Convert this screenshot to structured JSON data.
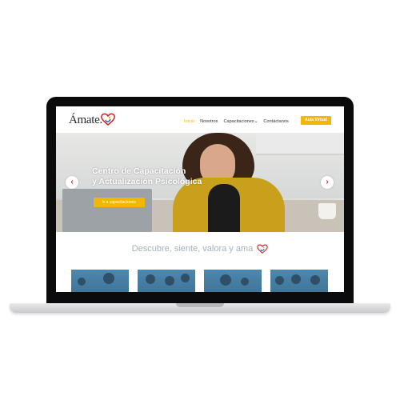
{
  "site": {
    "logo_text": "Ámate.",
    "nav": [
      "Inicio",
      "Nosotros",
      "Capacitaciones",
      "Contáctanos"
    ],
    "nav_dropdown_marker": "⌄",
    "cta": "Aula Virtual"
  },
  "hero": {
    "title_line1": "Centro de Capacitación",
    "title_line2": "y Actualización Psicológica",
    "button": "Ir a capacitaciones",
    "prev": "‹",
    "next": "›"
  },
  "section": {
    "slogan": "Descubre, siente, valora y ama"
  },
  "colors": {
    "brand_yellow": "#f2b705",
    "heart_red": "#d0222a",
    "heart_blue": "#2a7ab8",
    "slogan_gray": "#a7b1b7"
  }
}
